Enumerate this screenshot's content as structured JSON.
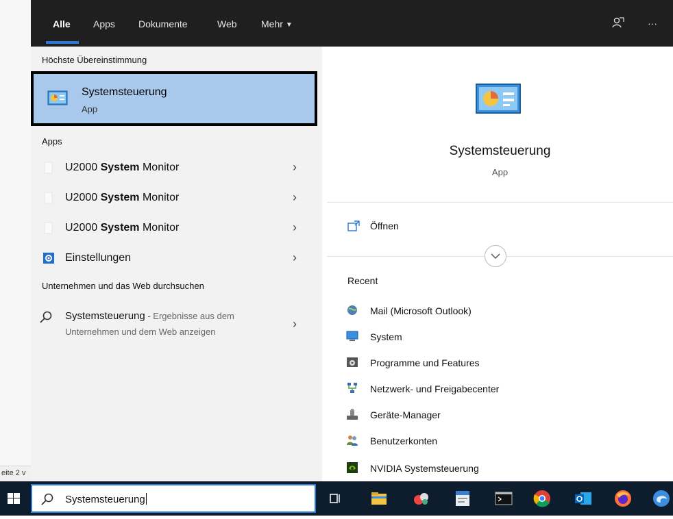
{
  "status_bar": {
    "page_text": "eite 2 v"
  },
  "tabs": {
    "items": [
      {
        "label": "Alle",
        "active": true
      },
      {
        "label": "Apps",
        "active": false
      },
      {
        "label": "Dokumente",
        "active": false
      },
      {
        "label": "Web",
        "active": false
      },
      {
        "label": "Mehr",
        "active": false,
        "has_dropdown": true
      }
    ],
    "right_icons": [
      "feedback-icon",
      "more-options-icon"
    ],
    "more_glyph": "···"
  },
  "best_match": {
    "section_title": "Höchste Übereinstimmung",
    "title": "Systemsteuerung",
    "subtitle": "App",
    "icon": "control-panel-icon"
  },
  "apps": {
    "section_title": "Apps",
    "items": [
      {
        "prefix": "U2000 ",
        "bold": "System",
        "suffix": " Monitor",
        "icon": "blank-app-icon"
      },
      {
        "prefix": "U2000 ",
        "bold": "System",
        "suffix": " Monitor",
        "icon": "blank-app-icon"
      },
      {
        "prefix": "U2000 ",
        "bold": "System",
        "suffix": " Monitor",
        "icon": "blank-app-icon"
      },
      {
        "prefix": "Einstellungen",
        "bold": "",
        "suffix": "",
        "icon": "settings-gear-icon"
      }
    ]
  },
  "web_search": {
    "section_title": "Unternehmen und das Web durchsuchen",
    "query": "Systemsteuerung",
    "hint_line1": " - Ergebnisse aus dem",
    "hint_line2": "Unternehmen und dem Web anzeigen"
  },
  "preview": {
    "title": "Systemsteuerung",
    "subtitle": "App",
    "open_label": "Öffnen",
    "recent_title": "Recent",
    "recent": [
      {
        "label": "Mail (Microsoft Outlook)",
        "icon": "mail-globe-icon"
      },
      {
        "label": "System",
        "icon": "system-monitor-icon"
      },
      {
        "label": "Programme und Features",
        "icon": "programs-features-icon"
      },
      {
        "label": "Netzwerk- und Freigabecenter",
        "icon": "network-center-icon"
      },
      {
        "label": "Geräte-Manager",
        "icon": "device-manager-icon"
      },
      {
        "label": "Benutzerkonten",
        "icon": "user-accounts-icon"
      },
      {
        "label": "NVIDIA Systemsteuerung",
        "icon": "nvidia-icon"
      }
    ]
  },
  "taskbar": {
    "search_value": "Systemsteuerung",
    "apps": [
      "task-view-icon",
      "file-explorer-icon",
      "snipping-tool-icon",
      "window-app-icon",
      "terminal-icon",
      "chrome-icon",
      "outlook-icon",
      "firefox-icon",
      "edge-icon"
    ]
  },
  "colors": {
    "accent": "#2c78d6",
    "highlight": "#a8c9ec",
    "tabs_bg": "#1f1f1f",
    "taskbar_bg": "#0d1d2e"
  }
}
